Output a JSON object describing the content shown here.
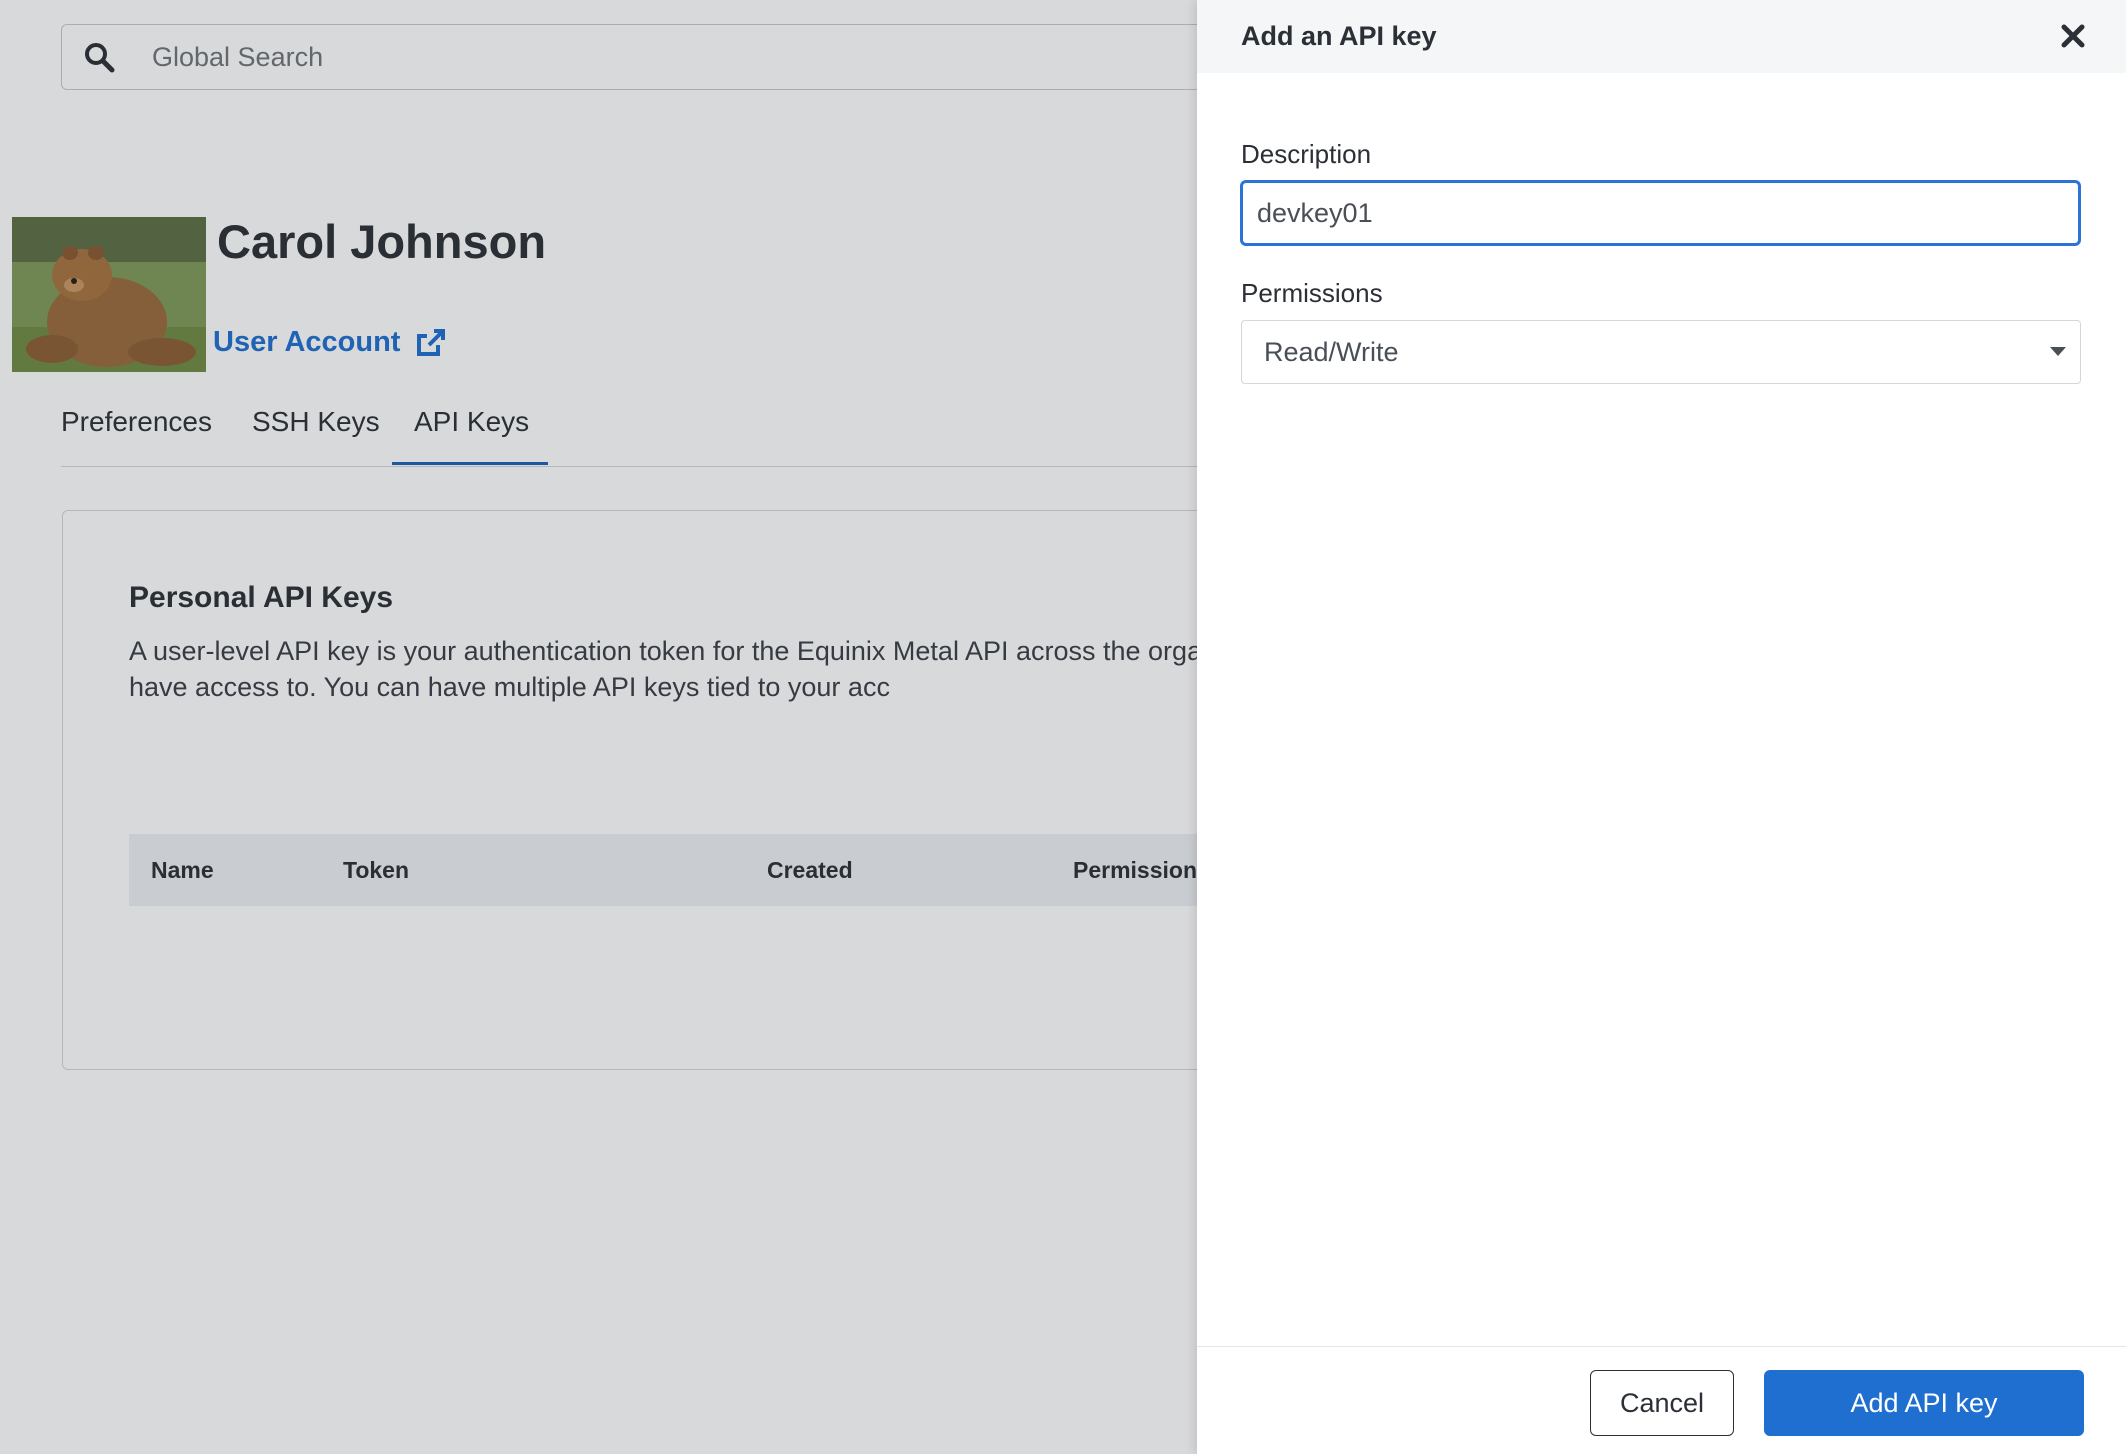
{
  "search": {
    "placeholder": "Global Search",
    "icon": "search-icon"
  },
  "profile": {
    "name": "Carol Johnson",
    "account_link": "User Account",
    "avatar_alt": "profile photo"
  },
  "tabs": [
    {
      "label": "Preferences",
      "active": false
    },
    {
      "label": "SSH Keys",
      "active": false
    },
    {
      "label": "API Keys",
      "active": true
    }
  ],
  "api_card": {
    "title": "Personal API Keys",
    "description": "A user-level API key is your authentication token for the Equinix Metal API across the organizations that you have access to. You can have multiple API keys tied to your acc",
    "columns": [
      "Name",
      "Token",
      "Created",
      "Permission"
    ]
  },
  "drawer": {
    "title": "Add an API key",
    "description_label": "Description",
    "description_value": "devkey01",
    "permissions_label": "Permissions",
    "permissions_value": "Read/Write",
    "cancel_label": "Cancel",
    "submit_label": "Add API key"
  },
  "colors": {
    "accent": "#1f6fd1",
    "focus_border": "#2a74d8",
    "overlay": "rgba(40,44,52,0.18)"
  }
}
